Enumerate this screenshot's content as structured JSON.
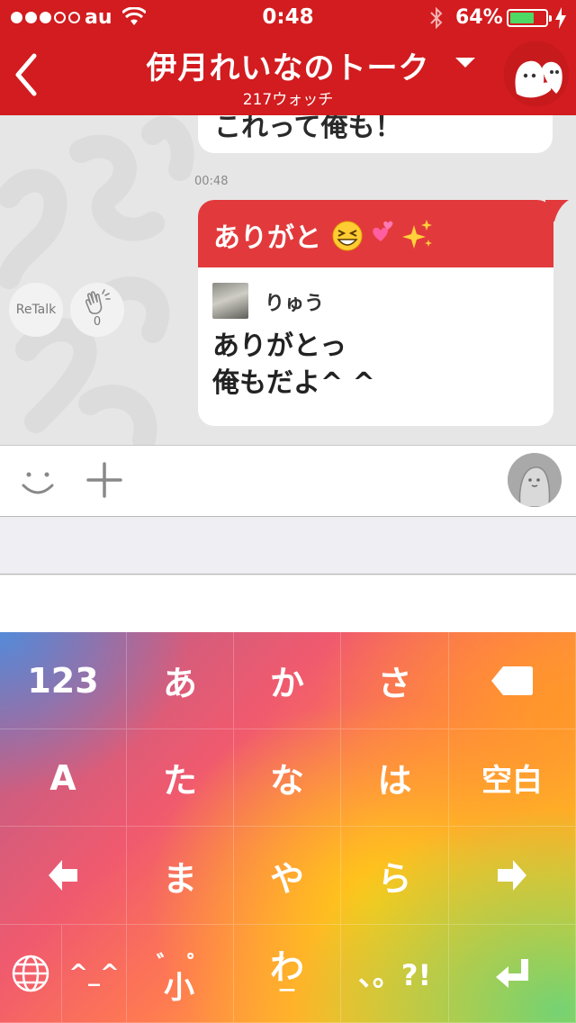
{
  "status_bar": {
    "carrier": "au",
    "time": "0:48",
    "battery_percent": "64%",
    "battery_level": 0.64,
    "signal_bars_filled": 3,
    "signal_bars_total": 5,
    "icons": [
      "wifi-icon",
      "bluetooth-icon",
      "battery-icon",
      "charging-icon"
    ]
  },
  "header": {
    "title": "伊月れいなのトーク",
    "subtitle": "217ウォッチ",
    "back_icon": "chevron-left-icon",
    "dropdown_icon": "caret-down-icon",
    "avatar_icon": "ghost-avatar-icon"
  },
  "chat": {
    "previous_message_fragment": "これって俺も！",
    "timestamp": "00:48",
    "message": {
      "header_text": "ありがと",
      "header_emojis": [
        "grinning-squint-emoji",
        "two-hearts-emoji",
        "sparkles-emoji"
      ],
      "quote_author": "りゅう",
      "quote_lines": [
        "ありがとっ",
        "俺もだよ^ ^"
      ]
    },
    "retalk_label": "ReTalk",
    "clap_count": "0"
  },
  "input_bar": {
    "smile_icon": "smile-icon",
    "plus_icon": "plus-icon",
    "avatar_icon": "user-avatar-icon"
  },
  "keyboard": {
    "rows": [
      [
        "123",
        "あ",
        "か",
        "さ",
        "⌫"
      ],
      [
        "A",
        "た",
        "な",
        "は",
        "空白"
      ],
      [
        "◀",
        "ま",
        "や",
        "ら",
        "▶"
      ],
      [
        "🌐",
        "^_^",
        "゛゜小",
        "わ",
        "、。?!",
        "⏎"
      ]
    ],
    "wa_sub": "ー",
    "dakuten_label": "小",
    "colors": {
      "header_red": "#d21c1f",
      "bubble_red": "#e23a3c",
      "battery_green": "#4cd964"
    }
  }
}
